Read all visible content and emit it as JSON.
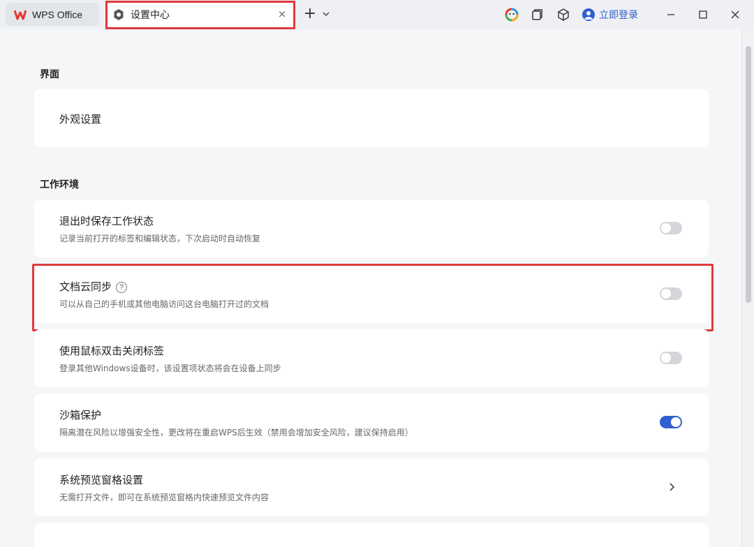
{
  "titlebar": {
    "home_tab": {
      "label": "WPS Office",
      "icon": "wps-logo-icon"
    },
    "active_tab": {
      "label": "设置中心",
      "icon": "settings-gear-icon",
      "close": "×"
    },
    "new_tab": "+",
    "login_label": "立即登录"
  },
  "sections": {
    "interface": {
      "title": "界面",
      "appearance": {
        "title": "外观设置"
      }
    },
    "workspace": {
      "title": "工作环境",
      "items": [
        {
          "title": "退出时保存工作状态",
          "desc": "记录当前打开的标签和编辑状态，下次启动时自动恢复",
          "toggle": "off"
        },
        {
          "title": "文档云同步",
          "help": "?",
          "desc": "可以从自己的手机或其他电脑访问这台电脑打开过的文档",
          "toggle": "off"
        },
        {
          "title": "使用鼠标双击关闭标签",
          "desc": "登录其他Windows设备时，该设置项状态将会在设备上同步",
          "toggle": "off"
        },
        {
          "title": "沙箱保护",
          "desc": "隔离潜在风险以增强安全性，更改将在重启WPS后生效（禁用会增加安全风险，建议保持启用）",
          "toggle": "on"
        },
        {
          "title": "系统预览窗格设置",
          "desc": "无需打开文件，即可在系统预览窗格内快速预览文件内容",
          "action": "chevron-right-icon"
        }
      ]
    }
  },
  "colors": {
    "accent": "#2f5fd0",
    "highlight": "#e03b3b",
    "wps_red": "#e3382e"
  }
}
